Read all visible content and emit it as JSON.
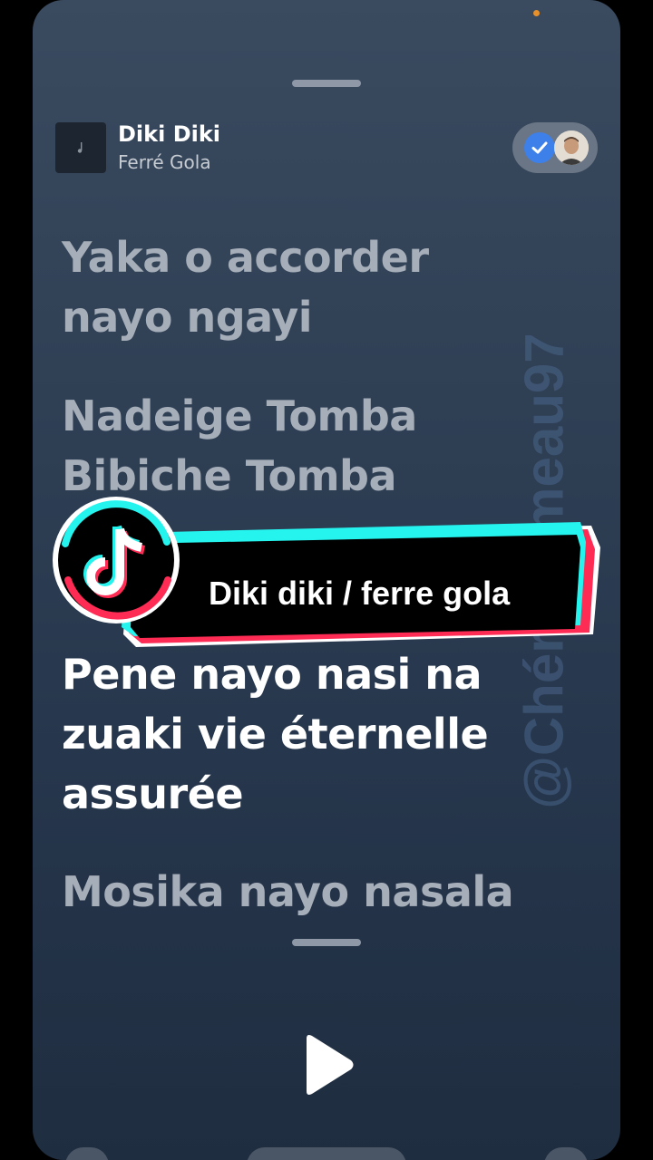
{
  "now_playing": {
    "title": "Diki Diki",
    "artist": "Ferré Gola",
    "artwork_icon": "music-note-icon",
    "share_icon": "check-icon"
  },
  "lyrics": [
    {
      "line1": "Yaka o accorder",
      "line2": "nayo ngayi",
      "line3": "",
      "active": false
    },
    {
      "line1": "Nadeige Tomba",
      "line2": "Bibiche Tomba",
      "line3": "",
      "active": false
    },
    {
      "line1": "Pene nayo nasi na",
      "line2": "zuaki vie éternelle",
      "line3": "assurée",
      "active": true
    },
    {
      "line1": "Mosika nayo nasala",
      "line2": "",
      "line3": "",
      "active": false
    }
  ],
  "player": {
    "play_icon": "play-icon"
  },
  "overlay": {
    "sticker_text": "Diki diki / ferre gola",
    "sticker_logo": "tiktok-logo-icon",
    "watermark": "@Chéru..umeau97"
  },
  "colors": {
    "background_top": "#3a4a5f",
    "background_bottom": "#1f2d40",
    "lyric_active": "#ffffff",
    "lyric_inactive": "#a6aeb9",
    "accent_cyan": "#25f4ee",
    "accent_red": "#fe2c55",
    "check_blue": "#3d80ea"
  }
}
